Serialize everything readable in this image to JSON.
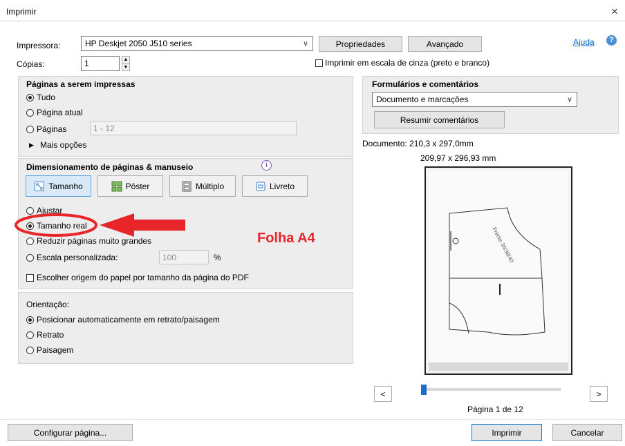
{
  "window": {
    "title": "Imprimir",
    "close": "×"
  },
  "printer": {
    "label": "Impressora:",
    "value": "HP Deskjet 2050 J510 series",
    "properties": "Propriedades",
    "advanced": "Avançado",
    "help": "Ajuda",
    "copies_label": "Cópias:",
    "copies_value": "1",
    "grayscale": "Imprimir em escala de cinza (preto e branco)",
    "grayscale_checked": false
  },
  "pages": {
    "heading": "Páginas a serem impressas",
    "all": "Tudo",
    "current": "Página atual",
    "pages": "Páginas",
    "range_placeholder": "1 - 12",
    "more": "Mais opções",
    "selected": "all"
  },
  "sizing": {
    "heading": "Dimensionamento de páginas & manuseio",
    "tabs": [
      "Tamanho",
      "Pôster",
      "Múltiplo",
      "Livreto"
    ],
    "active_tab": 0,
    "fit": "Ajustar",
    "actual": "Tamanho real",
    "shrink": "Reduzir páginas muito grandes",
    "custom": "Escala personalizada:",
    "custom_value": "100",
    "percent": "%",
    "choose_paper": "Escolher origem do papel por tamanho da página do PDF",
    "selected": "actual"
  },
  "annotation": {
    "text": "Folha A4",
    "color": "#e8262a"
  },
  "orientation": {
    "heading": "Orientação:",
    "auto": "Posicionar automaticamente em retrato/paisagem",
    "portrait": "Retrato",
    "landscape": "Paisagem",
    "selected": "auto"
  },
  "forms": {
    "heading": "Formulários e comentários",
    "value": "Documento e marcações",
    "summarize": "Resumir comentários"
  },
  "preview": {
    "document": "Documento: 210,3 x 297,0mm",
    "size": "209,97 x 296,93 mm",
    "pattern_text": "Frente 36/38/40",
    "prev": "<",
    "next": ">",
    "page_info": "Página 1 de 12",
    "current_page": 1,
    "total_pages": 12
  },
  "footer": {
    "setup": "Configurar página...",
    "print": "Imprimir",
    "cancel": "Cancelar"
  },
  "colors": {
    "accent": "#0078d7",
    "link": "#0066cc",
    "annotation": "#e8262a"
  }
}
